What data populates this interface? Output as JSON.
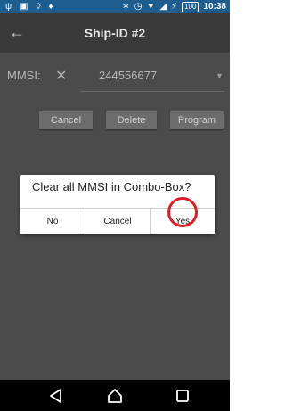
{
  "status_bar": {
    "left_icons": [
      "usb-icon",
      "image-icon",
      "location-icon",
      "settings-icon"
    ],
    "right_icons": [
      "bluetooth-icon",
      "alarm-icon",
      "wifi-icon",
      "signal-icon",
      "battery-icon"
    ],
    "battery_label": "100",
    "time": "10:38",
    "color": "#1e5d8f"
  },
  "toolbar": {
    "title": "Ship-ID #2"
  },
  "form": {
    "mmsi_label": "MMSI:",
    "mmsi_value": "244556677",
    "buttons": {
      "cancel": "Cancel",
      "delete": "Delete",
      "program": "Program"
    }
  },
  "dialog": {
    "message": "Clear all MMSI in Combo-Box?",
    "no_label": "No",
    "cancel_label": "Cancel",
    "yes_label": "Yes",
    "highlight_color": "#e01b24"
  },
  "nav": {
    "icons": [
      "back-icon",
      "home-icon",
      "recents-icon"
    ]
  }
}
